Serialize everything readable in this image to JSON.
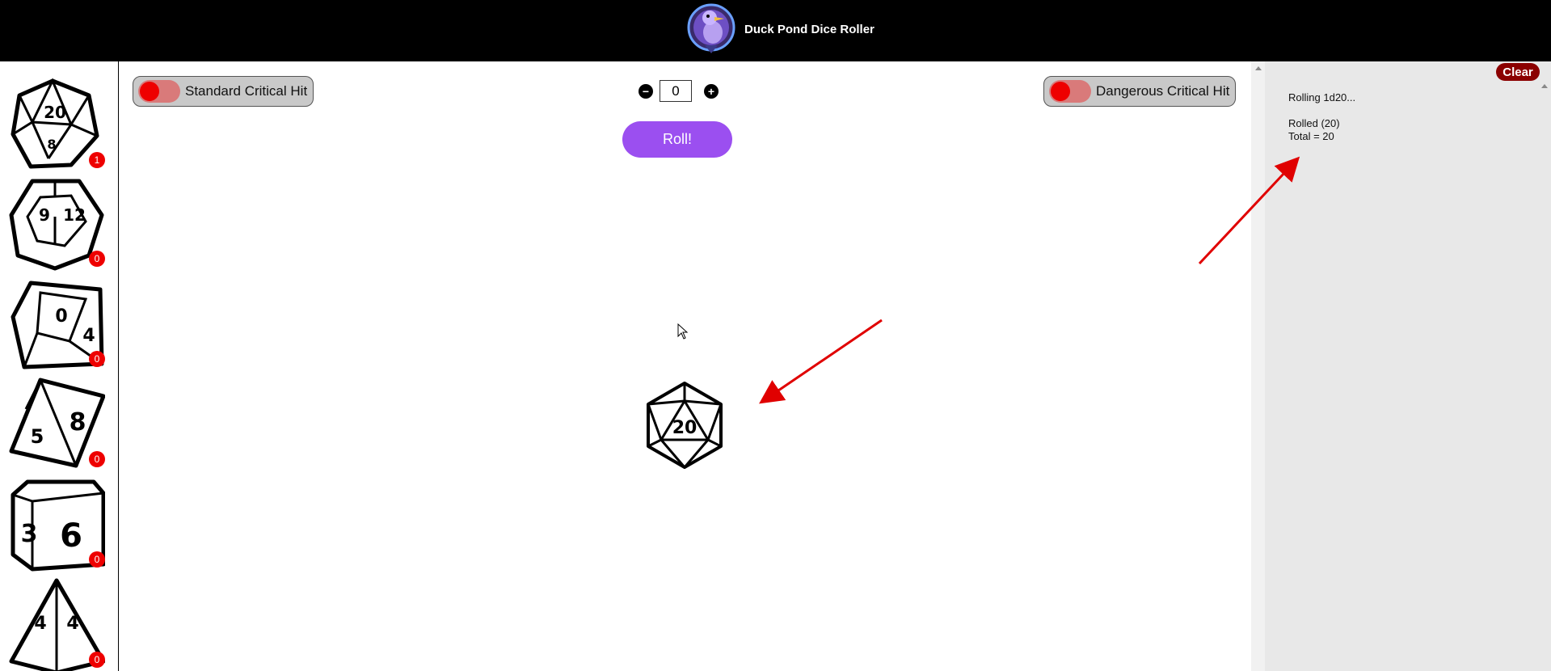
{
  "header": {
    "title": "Duck Pond Dice Roller",
    "logo_icon": "duck-logo-icon"
  },
  "dice": [
    {
      "name": "d20",
      "face": "20",
      "count": "1"
    },
    {
      "name": "d12",
      "face": "12",
      "count": "0"
    },
    {
      "name": "d10",
      "face": "0",
      "count": "0"
    },
    {
      "name": "d8",
      "face": "8",
      "count": "0"
    },
    {
      "name": "d6",
      "face": "6",
      "count": "0"
    },
    {
      "name": "d4",
      "face": "4",
      "count": "0"
    }
  ],
  "toggles": {
    "standard_label": "Standard Critical Hit",
    "dangerous_label": "Dangerous Critical Hit",
    "standard_on": false,
    "dangerous_on": false
  },
  "modifier": {
    "minus_icon": "minus-icon",
    "plus_icon": "plus-icon",
    "value": "0"
  },
  "roll": {
    "label": "Roll!"
  },
  "result": {
    "die": "d20",
    "value": "20"
  },
  "log": {
    "clear_label": "Clear",
    "lines": [
      "Rolling 1d20...",
      "Rolled (20)",
      "Total = 20"
    ]
  },
  "colors": {
    "header_bg": "#000000",
    "roll_button": "#9b4ff0",
    "badge": "#ee0000",
    "clear_button": "#8b0000",
    "annotation_arrow": "#e00000"
  }
}
